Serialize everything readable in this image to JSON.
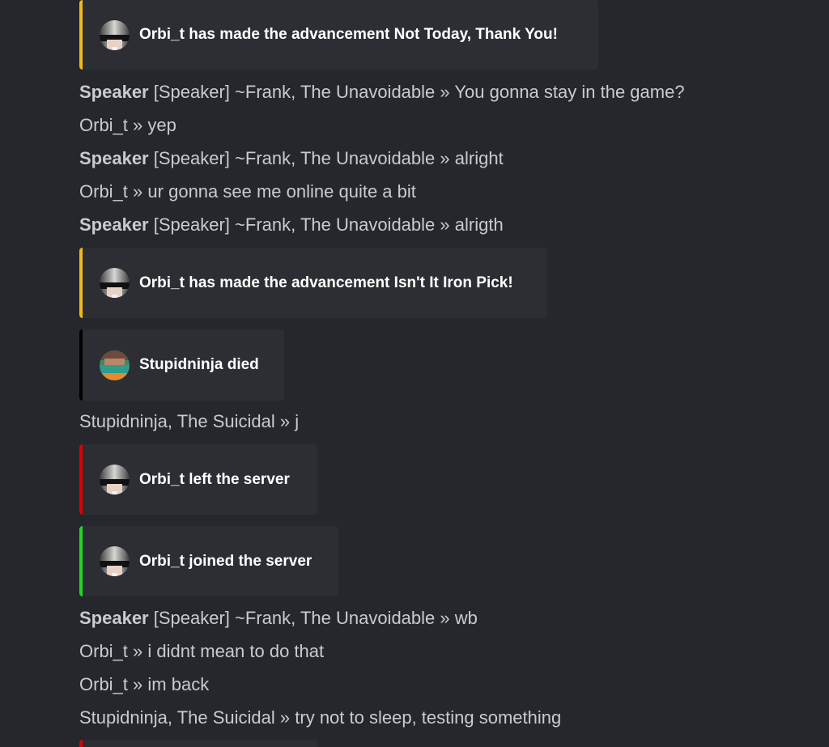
{
  "colors": {
    "background": "#25272c",
    "embed_bg": "#2c2e33",
    "advancement": "#f0b81b",
    "death": "#000000",
    "leave": "#e00000",
    "join": "#1fd81f",
    "text": "#c9cbcf"
  },
  "embeds": {
    "adv1": {
      "text": "Orbi_t has made the advancement Not Today, Thank You!",
      "avatar": "orbi-t-avatar"
    },
    "adv2": {
      "text": "Orbi_t has made the advancement Isn't It Iron Pick!",
      "avatar": "orbi-t-avatar"
    },
    "death": {
      "text": "Stupidninja died",
      "avatar": "stupidninja-avatar"
    },
    "left": {
      "text": "Orbi_t left the server",
      "avatar": "orbi-t-avatar"
    },
    "joined": {
      "text": "Orbi_t joined the server",
      "avatar": "orbi-t-avatar"
    }
  },
  "messages": [
    {
      "speaker": "Speaker",
      "prefix": "[Speaker] ~Frank, The Unavoidable",
      "sep": "»",
      "text": "You gonna stay in the game?"
    },
    {
      "speaker": "",
      "prefix": "Orbi_t",
      "sep": "»",
      "text": "yep"
    },
    {
      "speaker": "Speaker",
      "prefix": "[Speaker] ~Frank, The Unavoidable",
      "sep": "»",
      "text": "alright"
    },
    {
      "speaker": "",
      "prefix": "Orbi_t",
      "sep": "»",
      "text": "ur gonna see me online quite a bit"
    },
    {
      "speaker": "Speaker",
      "prefix": "[Speaker] ~Frank, The Unavoidable",
      "sep": "»",
      "text": "alrigth"
    },
    {
      "speaker": "",
      "prefix": "Stupidninja, The Suicidal",
      "sep": "»",
      "text": "j"
    },
    {
      "speaker": "Speaker",
      "prefix": "[Speaker] ~Frank, The Unavoidable",
      "sep": "»",
      "text": "wb"
    },
    {
      "speaker": "",
      "prefix": "Orbi_t",
      "sep": "»",
      "text": "i didnt mean to do that"
    },
    {
      "speaker": "",
      "prefix": "Orbi_t",
      "sep": "»",
      "text": "im back"
    },
    {
      "speaker": "",
      "prefix": "Stupidninja, The Suicidal",
      "sep": "»",
      "text": "try not to sleep, testing something"
    }
  ]
}
